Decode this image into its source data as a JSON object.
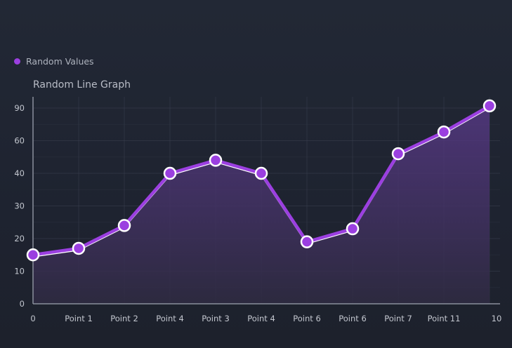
{
  "legend": {
    "label": "Random Values",
    "color": "#9b3fe0"
  },
  "colors": {
    "line": "#9b3fe0",
    "line_highlight": "#ffffff",
    "marker_fill": "#9b3fe0",
    "marker_stroke": "#ffffff",
    "grid": "#3a4050",
    "axis": "#8a8f9c",
    "area_top": "#5a3a8a",
    "area_bottom": "#2a2a3e"
  },
  "chart_data": {
    "type": "area",
    "title": "Random Line Graph",
    "xlabel": "",
    "ylabel": "",
    "categories": [
      "0",
      "Point 1",
      "Point 2",
      "Point 4",
      "Point 3",
      "Point 4",
      "Point 6",
      "Point 6",
      "Point 7",
      "Point 11",
      "10"
    ],
    "y_ticks": [
      "0",
      "10",
      "20",
      "30",
      "40",
      "60",
      "90"
    ],
    "series": [
      {
        "name": "Random Values",
        "values": [
          15,
          17,
          24,
          40,
          48,
          40,
          19,
          23,
          52,
          68,
          92
        ]
      }
    ],
    "grid": true,
    "legend_position": "top-left"
  }
}
